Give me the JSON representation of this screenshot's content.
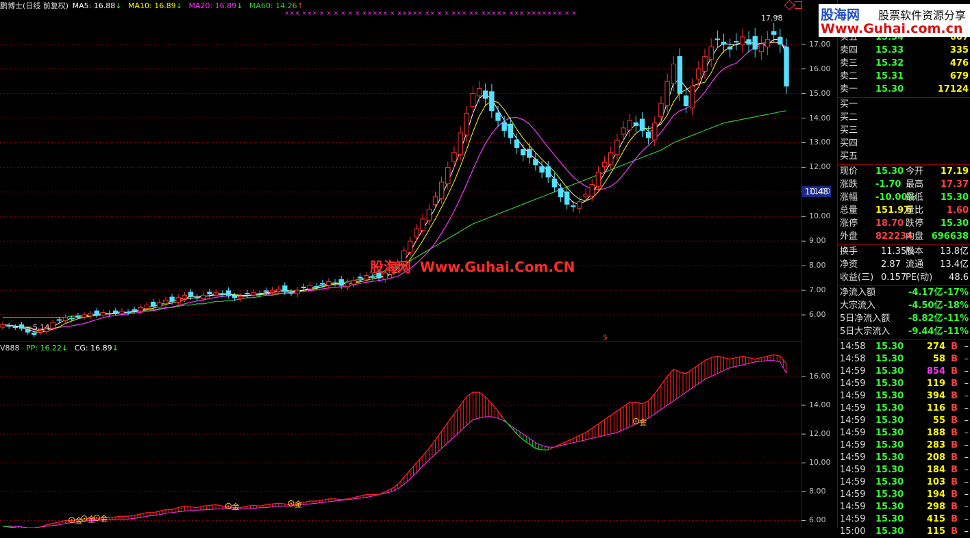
{
  "main_legend": {
    "name": "鹏博士(日线 前复权)",
    "ma5": "MA5: 16.88",
    "ma10": "MA10: 16.89",
    "ma20": "MA20: 16.89",
    "ma60": "MA60: 14.26",
    "arrow_down": "↓",
    "arrow_up": "↑"
  },
  "sub_legend": {
    "name": "V888",
    "pp": "PP: 16.22",
    "cg": "CG: 16.89",
    "arrow_down": "↓"
  },
  "annotations": {
    "high": "17.98",
    "low": "5.14",
    "sub_marker": "$",
    "gold": "金"
  },
  "main_axis_ticks": [
    "17.00",
    "16.00",
    "15.00",
    "14.00",
    "13.00",
    "12.00",
    "11.00",
    "10.00",
    "9.00",
    "8.00",
    "7.00",
    "6.00"
  ],
  "sub_axis_ticks": [
    "16.00",
    "14.00",
    "12.00",
    "10.00",
    "8.00",
    "6.00"
  ],
  "current_price_box": "10.48",
  "watermark": {
    "cn": "股海网",
    "url": "Www.Guhai.Com.CN"
  },
  "logo": {
    "name": "股海网",
    "slogan": "股票软件资源分享",
    "url": "Www.Guhai.com.cn"
  },
  "order_book": {
    "asks": [
      {
        "label": "卖五",
        "price": "15.34",
        "vol": "667"
      },
      {
        "label": "卖四",
        "price": "15.33",
        "vol": "335"
      },
      {
        "label": "卖三",
        "price": "15.32",
        "vol": "476"
      },
      {
        "label": "卖二",
        "price": "15.31",
        "vol": "679"
      },
      {
        "label": "卖一",
        "price": "15.30",
        "vol": "17124"
      }
    ],
    "bids": [
      {
        "label": "买一"
      },
      {
        "label": "买二"
      },
      {
        "label": "买三"
      },
      {
        "label": "买四"
      },
      {
        "label": "买五"
      }
    ]
  },
  "quote": [
    {
      "l1": "现价",
      "v1": "15.30",
      "l2": "今开",
      "v2": "17.19"
    },
    {
      "l1": "涨跌",
      "v1": "-1.70",
      "l2": "最高",
      "v2": "17.37"
    },
    {
      "l1": "涨幅",
      "v1": "-10.00%",
      "l2": "最低",
      "v2": "15.30"
    },
    {
      "l1": "总量",
      "v1": "151.9万",
      "l2": "量比",
      "v2": "1.60"
    },
    {
      "l1": "涨停",
      "v1": "18.70",
      "l2": "跌停",
      "v2": "15.30"
    },
    {
      "l1": "外盘",
      "v1": "822234",
      "l2": "内盘",
      "v2": "696638"
    }
  ],
  "fundamentals": [
    {
      "l1": "换手",
      "v1": "11.35%",
      "l2": "股本",
      "v2": "13.8亿"
    },
    {
      "l1": "净资",
      "v1": "2.87",
      "l2": "流通",
      "v2": "13.4亿"
    },
    {
      "l1": "收益(三)",
      "v1": "0.157",
      "l2": "PE(动)",
      "v2": "48.6"
    }
  ],
  "flows": [
    {
      "label": "净流入额",
      "val": "-4.17亿",
      "pct": "-17%"
    },
    {
      "label": "大宗流入",
      "val": "-4.50亿",
      "pct": "-18%"
    },
    {
      "label": "5日净流入额",
      "val": "-8.82亿",
      "pct": "-11%"
    },
    {
      "label": "5日大宗流入",
      "val": "-9.44亿",
      "pct": "-11%"
    }
  ],
  "ticks": [
    {
      "t": "14:58",
      "p": "15.30",
      "v": "274",
      "s": "B",
      "d": "–"
    },
    {
      "t": "14:58",
      "p": "15.30",
      "v": "58",
      "s": "B",
      "d": "–"
    },
    {
      "t": "14:59",
      "p": "15.30",
      "v": "854",
      "s": "B",
      "d": "–"
    },
    {
      "t": "14:59",
      "p": "15.30",
      "v": "119",
      "s": "B",
      "d": "–"
    },
    {
      "t": "14:59",
      "p": "15.30",
      "v": "394",
      "s": "B",
      "d": "–"
    },
    {
      "t": "14:59",
      "p": "15.30",
      "v": "116",
      "s": "B",
      "d": "–"
    },
    {
      "t": "14:59",
      "p": "15.30",
      "v": "55",
      "s": "B",
      "d": "–"
    },
    {
      "t": "14:59",
      "p": "15.30",
      "v": "188",
      "s": "B",
      "d": "–"
    },
    {
      "t": "14:59",
      "p": "15.30",
      "v": "283",
      "s": "B",
      "d": "–"
    },
    {
      "t": "14:59",
      "p": "15.30",
      "v": "208",
      "s": "B",
      "d": "–"
    },
    {
      "t": "14:59",
      "p": "15.30",
      "v": "184",
      "s": "B",
      "d": "–"
    },
    {
      "t": "14:59",
      "p": "15.30",
      "v": "103",
      "s": "B",
      "d": "–"
    },
    {
      "t": "14:59",
      "p": "15.30",
      "v": "194",
      "s": "B",
      "d": "–"
    },
    {
      "t": "14:59",
      "p": "15.30",
      "v": "298",
      "s": "B",
      "d": "–"
    },
    {
      "t": "14:59",
      "p": "15.30",
      "v": "415",
      "s": "B",
      "d": "–"
    },
    {
      "t": "15:00",
      "p": "15.30",
      "v": "115",
      "s": "B",
      "d": "–"
    }
  ],
  "colors": {
    "up": "#ff3333",
    "down": "#55e0ff",
    "ma5": "#ffffff",
    "ma10": "#ffff00",
    "ma20": "#ff33ff",
    "ma60": "#33cc33",
    "grid": "#8b0000",
    "sub_up": "#ff2020",
    "sub_down": "#22cc22"
  },
  "chart_data": {
    "type": "candlestick",
    "closes": [
      5.6,
      5.55,
      5.5,
      5.45,
      5.3,
      5.2,
      5.35,
      5.5,
      5.7,
      5.8,
      5.9,
      5.85,
      5.95,
      6.0,
      6.05,
      6.0,
      6.1,
      6.05,
      6.1,
      6.15,
      6.1,
      6.2,
      6.3,
      6.4,
      6.35,
      6.5,
      6.6,
      6.55,
      6.7,
      6.8,
      6.75,
      6.7,
      6.8,
      6.85,
      6.9,
      6.85,
      6.8,
      6.7,
      6.75,
      6.85,
      6.9,
      6.85,
      6.95,
      7.0,
      7.05,
      6.95,
      6.9,
      7.0,
      7.1,
      7.2,
      7.15,
      7.25,
      7.35,
      7.3,
      7.2,
      7.3,
      7.4,
      7.5,
      7.6,
      7.55,
      7.5,
      7.7,
      7.9,
      8.1,
      8.6,
      9.0,
      9.5,
      9.9,
      10.3,
      10.8,
      11.4,
      12.0,
      12.6,
      13.4,
      14.2,
      15.0,
      15.2,
      14.8,
      14.3,
      13.9,
      13.5,
      13.2,
      12.8,
      12.5,
      12.4,
      12.1,
      11.8,
      11.6,
      11.2,
      10.8,
      10.5,
      10.4,
      10.6,
      10.9,
      11.3,
      11.8,
      12.2,
      12.6,
      13.1,
      13.6,
      13.9,
      13.7,
      13.5,
      13.2,
      13.8,
      14.6,
      15.5,
      16.2,
      15.0,
      14.5,
      15.3,
      16.0,
      16.5,
      16.9,
      17.2,
      17.0,
      16.8,
      17.1,
      17.3,
      17.0,
      16.8,
      17.0,
      17.2,
      17.4,
      17.0,
      15.3
    ],
    "ma60": [
      5.9,
      5.9,
      5.9,
      5.9,
      5.9,
      5.9,
      5.9,
      5.9,
      5.9,
      5.9,
      5.9,
      5.95,
      5.95,
      6.0,
      6.0,
      6.0,
      6.05,
      6.05,
      6.05,
      6.1,
      6.1,
      6.15,
      6.15,
      6.2,
      6.2,
      6.25,
      6.3,
      6.3,
      6.35,
      6.4,
      6.4,
      6.45,
      6.45,
      6.5,
      6.55,
      6.55,
      6.6,
      6.6,
      6.65,
      6.7,
      6.7,
      6.75,
      6.8,
      6.8,
      6.85,
      6.9,
      6.9,
      6.95,
      7.0,
      7.05,
      7.1,
      7.15,
      7.2,
      7.25,
      7.3,
      7.35,
      7.4,
      7.45,
      7.5,
      7.6,
      7.7,
      7.8,
      7.9,
      8.0,
      8.1,
      8.2,
      8.35,
      8.5,
      8.65,
      8.8,
      8.95,
      9.1,
      9.25,
      9.4,
      9.55,
      9.7,
      9.8,
      9.9,
      10.0,
      10.1,
      10.2,
      10.3,
      10.4,
      10.5,
      10.6,
      10.7,
      10.8,
      10.9,
      11.0,
      11.1,
      11.2,
      11.3,
      11.4,
      11.5,
      11.6,
      11.7,
      11.8,
      11.9,
      12.0,
      12.1,
      12.2,
      12.3,
      12.4,
      12.5,
      12.6,
      12.7,
      12.85,
      13.0,
      13.1,
      13.2,
      13.3,
      13.4,
      13.5,
      13.6,
      13.7,
      13.8,
      13.85,
      13.9,
      13.95,
      14.0,
      14.05,
      14.1,
      14.15,
      14.2,
      14.26,
      14.3
    ],
    "pp": [
      5.6,
      5.6,
      5.6,
      5.55,
      5.5,
      5.5,
      5.55,
      5.6,
      5.65,
      5.7,
      5.8,
      5.85,
      5.9,
      5.95,
      6.0,
      6.0,
      6.05,
      6.05,
      6.1,
      6.1,
      6.1,
      6.15,
      6.2,
      6.3,
      6.35,
      6.4,
      6.5,
      6.55,
      6.6,
      6.65,
      6.7,
      6.72,
      6.74,
      6.76,
      6.8,
      6.8,
      6.82,
      6.8,
      6.8,
      6.82,
      6.85,
      6.88,
      6.9,
      6.95,
      7.0,
      7.0,
      7.0,
      7.05,
      7.1,
      7.15,
      7.2,
      7.25,
      7.3,
      7.35,
      7.4,
      7.45,
      7.5,
      7.55,
      7.6,
      7.7,
      7.8,
      7.9,
      8.0,
      8.2,
      8.5,
      8.9,
      9.3,
      9.8,
      10.2,
      10.6,
      11.0,
      11.4,
      11.8,
      12.2,
      12.6,
      13.0,
      13.1,
      13.2,
      13.2,
      13.1,
      12.9,
      12.6,
      12.3,
      12.0,
      11.7,
      11.4,
      11.2,
      11.1,
      11.1,
      11.2,
      11.3,
      11.4,
      11.5,
      11.6,
      11.7,
      11.8,
      11.9,
      12.0,
      12.1,
      12.3,
      12.5,
      12.7,
      12.9,
      13.1,
      13.4,
      13.7,
      14.0,
      14.3,
      14.6,
      14.9,
      15.2,
      15.5,
      15.8,
      16.0,
      16.2,
      16.4,
      16.6,
      16.7,
      16.8,
      16.9,
      17.0,
      17.05,
      17.1,
      17.1,
      17.0,
      16.22
    ],
    "cg": [
      5.6,
      5.55,
      5.5,
      5.45,
      5.4,
      5.45,
      5.55,
      5.7,
      5.8,
      5.9,
      6.0,
      6.0,
      6.05,
      6.1,
      6.15,
      6.1,
      6.2,
      6.2,
      6.25,
      6.3,
      6.3,
      6.35,
      6.45,
      6.55,
      6.55,
      6.65,
      6.75,
      6.75,
      6.9,
      7.0,
      6.95,
      6.9,
      7.0,
      7.05,
      7.1,
      7.0,
      6.95,
      6.9,
      6.9,
      7.0,
      7.05,
      7.0,
      7.1,
      7.15,
      7.2,
      7.15,
      7.1,
      7.15,
      7.25,
      7.35,
      7.35,
      7.4,
      7.5,
      7.5,
      7.45,
      7.5,
      7.6,
      7.7,
      7.8,
      7.8,
      7.8,
      8.0,
      8.2,
      8.5,
      9.0,
      9.5,
      10.0,
      10.5,
      11.0,
      11.6,
      12.2,
      12.8,
      13.4,
      14.0,
      14.6,
      14.9,
      14.9,
      14.6,
      14.1,
      13.6,
      13.0,
      12.5,
      12.0,
      11.6,
      11.3,
      11.0,
      10.9,
      10.9,
      11.1,
      11.3,
      11.5,
      11.7,
      11.9,
      12.1,
      12.4,
      12.7,
      13.0,
      13.3,
      13.6,
      13.9,
      14.2,
      14.2,
      14.1,
      14.3,
      14.8,
      15.4,
      16.0,
      16.5,
      16.3,
      16.2,
      16.5,
      16.8,
      17.1,
      17.3,
      17.4,
      17.3,
      17.2,
      17.3,
      17.4,
      17.3,
      17.2,
      17.3,
      17.4,
      17.5,
      17.4,
      16.89
    ],
    "y_range_main": [
      5.0,
      18.3
    ],
    "y_range_sub": [
      5.5,
      17.8
    ]
  }
}
